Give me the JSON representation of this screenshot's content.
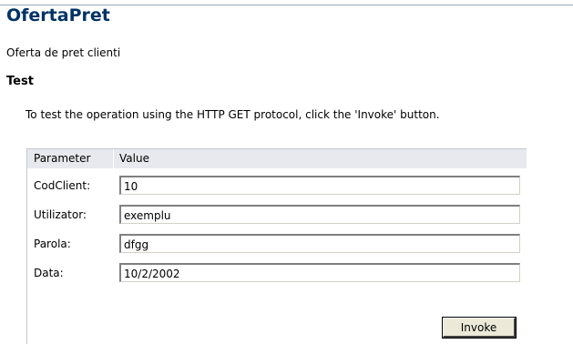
{
  "operation": {
    "title": "OfertaPret",
    "description": "Oferta de pret clienti"
  },
  "test": {
    "heading": "Test",
    "instructions": "To test the operation using the HTTP GET protocol, click the 'Invoke' button."
  },
  "form": {
    "headers": {
      "parameter": "Parameter",
      "value": "Value"
    },
    "parameters": [
      {
        "label": "CodClient:",
        "value": "10"
      },
      {
        "label": "Utilizator:",
        "value": "exemplu"
      },
      {
        "label": "Parola:",
        "value": "dfgg"
      },
      {
        "label": "Data:",
        "value": "10/2/2002"
      }
    ],
    "invoke_label": "Invoke"
  }
}
